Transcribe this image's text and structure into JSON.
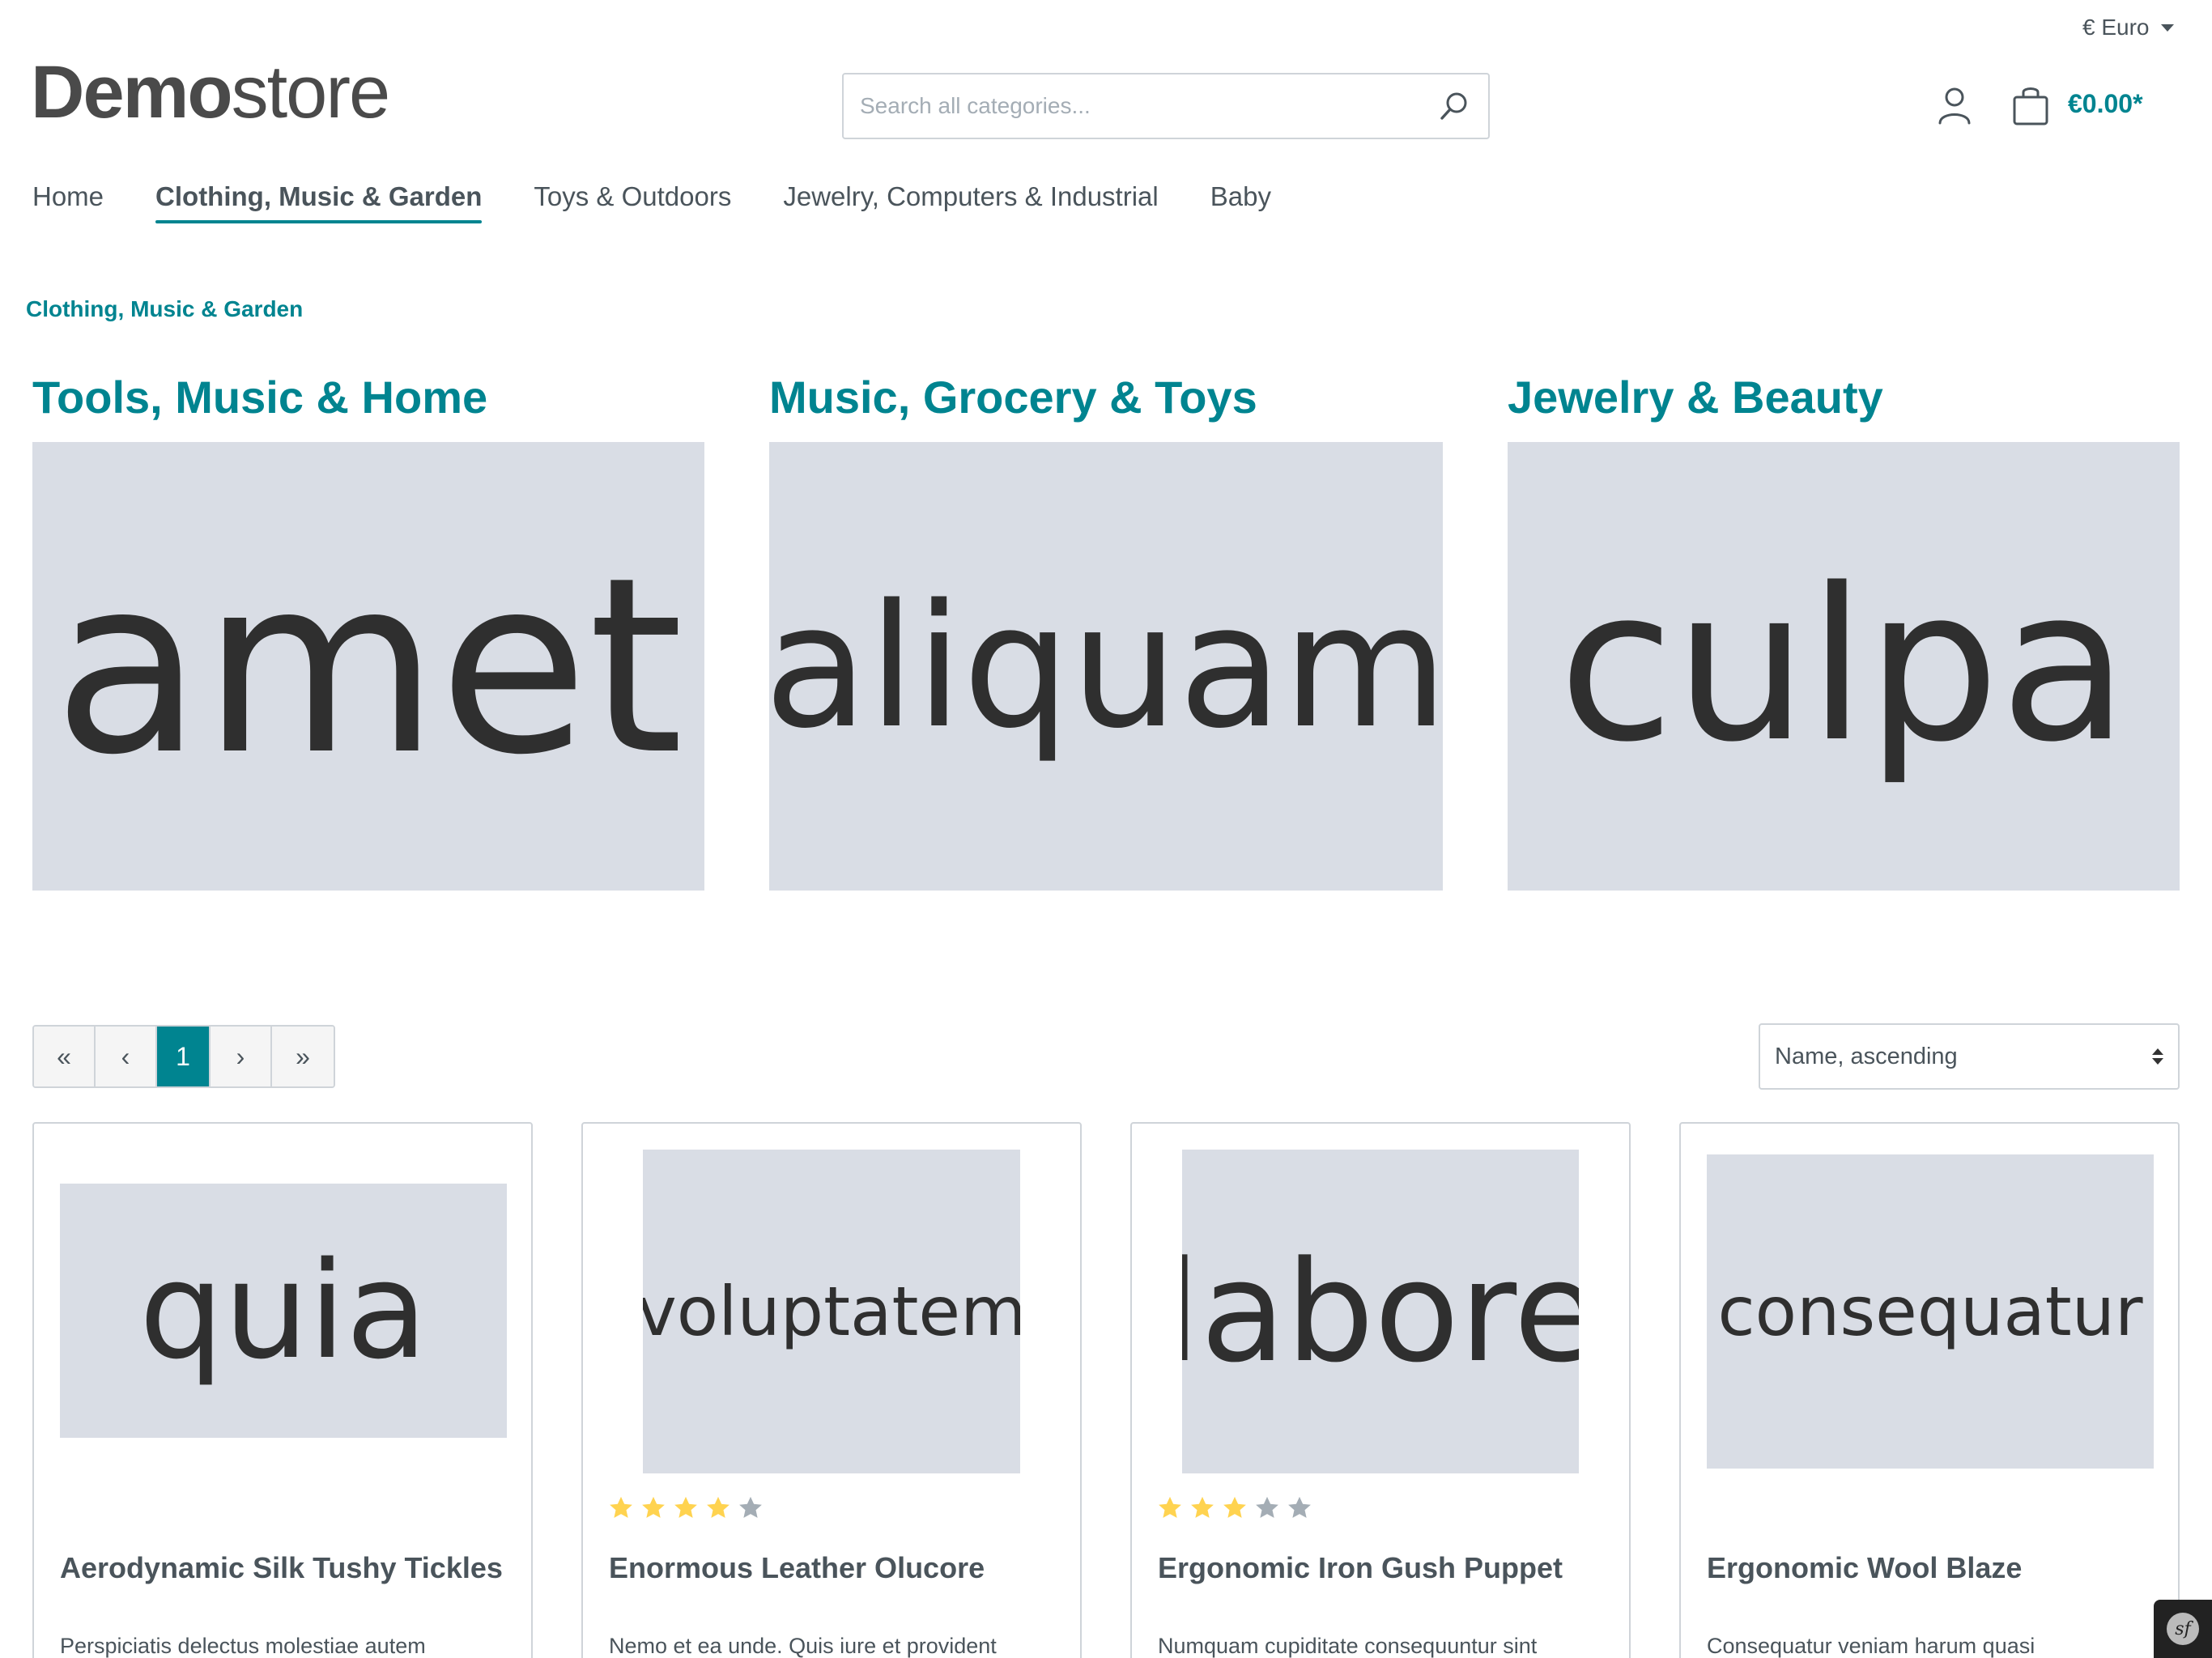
{
  "header": {
    "currency_label": "€ Euro",
    "logo_bold": "Demo",
    "logo_light": "store",
    "search_placeholder": "Search all categories...",
    "cart_total": "€0.00*"
  },
  "nav": {
    "items": [
      {
        "label": "Home"
      },
      {
        "label": "Clothing, Music & Garden"
      },
      {
        "label": "Toys & Outdoors"
      },
      {
        "label": "Jewelry, Computers & Industrial"
      },
      {
        "label": "Baby"
      }
    ],
    "active": "Clothing, Music & Garden"
  },
  "breadcrumb": "Clothing, Music & Garden",
  "categories": [
    {
      "title": "Tools, Music & Home",
      "image_text": "amet"
    },
    {
      "title": "Music, Grocery & Toys",
      "image_text": "aliquam"
    },
    {
      "title": "Jewelry & Beauty",
      "image_text": "culpa"
    }
  ],
  "pagination": {
    "first": "«",
    "prev": "‹",
    "current": "1",
    "next": "›",
    "last": "»"
  },
  "sort": {
    "selected": "Name, ascending"
  },
  "products": [
    {
      "name": "Aerodynamic Silk Tushy Tickles",
      "image_text": "quia",
      "rating": null,
      "description": "Perspiciatis delectus molestiae autem"
    },
    {
      "name": "Enormous Leather Olucore",
      "image_text": "voluptatem",
      "rating": 4,
      "description": "Nemo et ea unde. Quis iure et provident"
    },
    {
      "name": "Ergonomic Iron Gush Puppet",
      "image_text": "labore",
      "rating": 3,
      "description": "Numquam cupiditate consequuntur sint"
    },
    {
      "name": "Ergonomic Wool Blaze",
      "image_text": "consequatur",
      "rating": null,
      "description": "Consequatur veniam harum quasi"
    }
  ],
  "colors": {
    "accent": "#008490",
    "text": "#4a545b",
    "placeholder_bg": "#d9dde5",
    "star_filled": "#ffd350",
    "star_empty": "#a4adb5"
  },
  "icons": {
    "search": "search-icon",
    "account": "user-icon",
    "cart": "shopping-bag-icon",
    "dropdown": "caret-down-icon",
    "debug": "symfony-icon"
  }
}
